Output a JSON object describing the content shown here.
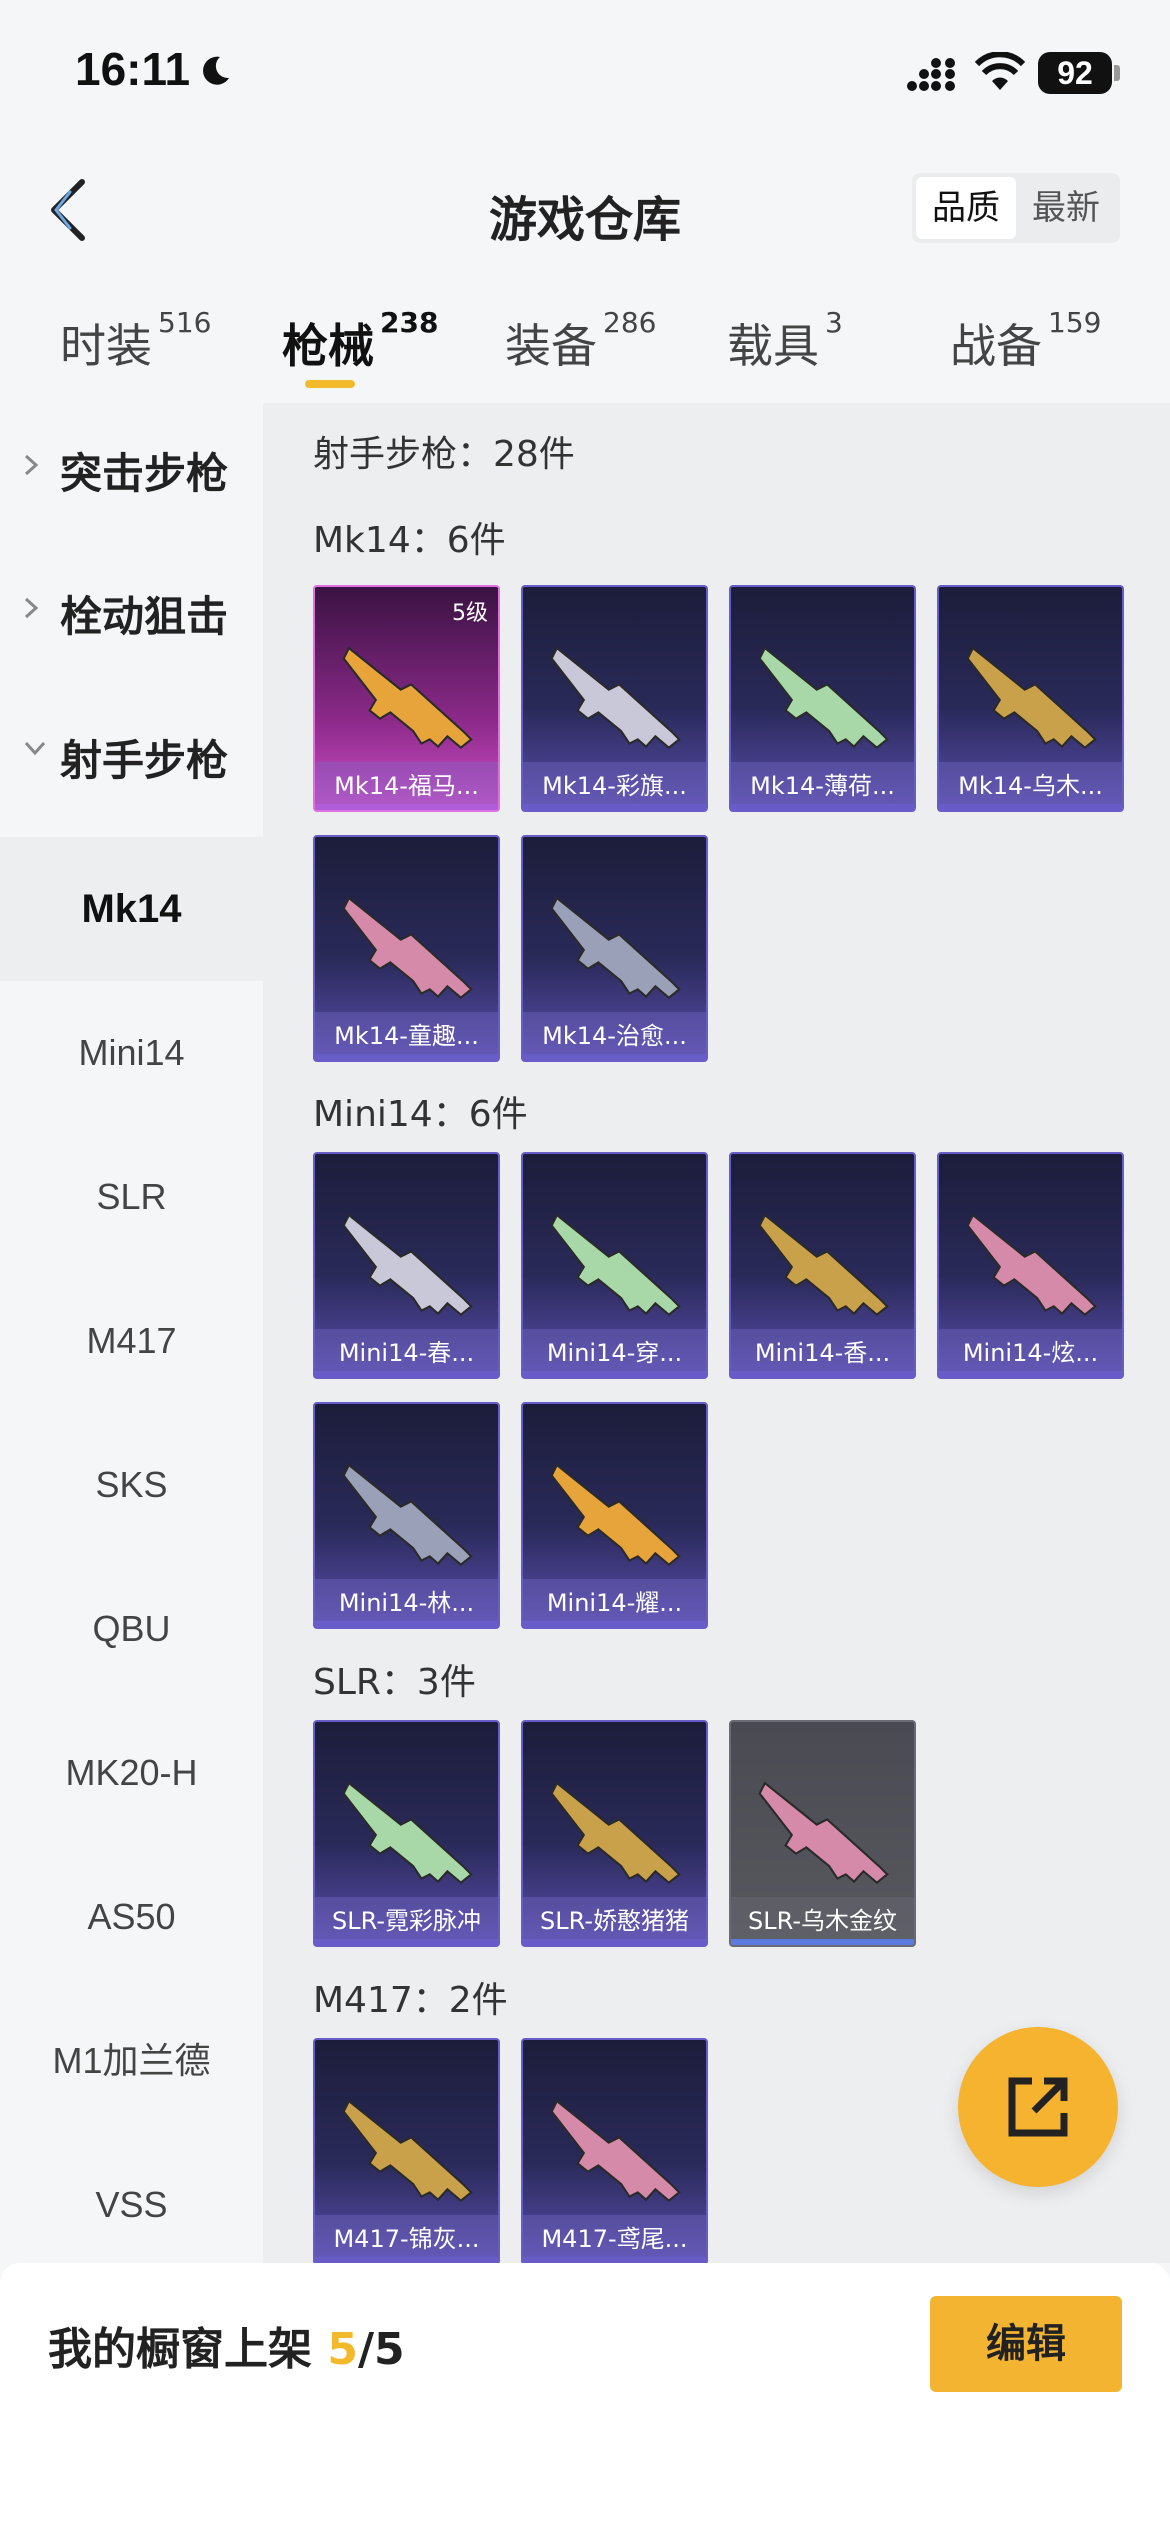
{
  "status": {
    "time": "16:11",
    "battery": "92"
  },
  "header": {
    "title": "游戏仓库",
    "sort": [
      "品质",
      "最新"
    ]
  },
  "tabs": [
    {
      "label": "时装",
      "count": "516"
    },
    {
      "label": "枪械",
      "count": "238"
    },
    {
      "label": "装备",
      "count": "286"
    },
    {
      "label": "载具",
      "count": "3"
    },
    {
      "label": "战备",
      "count": "159"
    }
  ],
  "sidebar": {
    "categories": [
      "突击步枪",
      "栓动狙击",
      "射手步枪"
    ],
    "subitems": [
      "Mk14",
      "Mini14",
      "SLR",
      "M417",
      "SKS",
      "QBU",
      "MK20-H",
      "AS50",
      "M1加兰德",
      "VSS"
    ]
  },
  "content": {
    "section_title": "射手步枪：28件",
    "groups": [
      {
        "title": "Mk14：6件",
        "items": [
          "Mk14-福马...",
          "Mk14-彩旗...",
          "Mk14-薄荷...",
          "Mk14-乌木...",
          "Mk14-童趣...",
          "Mk14-治愈..."
        ],
        "first_level": "5级"
      },
      {
        "title": "Mini14：6件",
        "items": [
          "Mini14-春...",
          "Mini14-穿...",
          "Mini14-香...",
          "Mini14-炫...",
          "Mini14-林...",
          "Mini14-耀..."
        ]
      },
      {
        "title": "SLR：3件",
        "items": [
          "SLR-霓彩脉冲",
          "SLR-娇憨猪猪",
          "SLR-乌木金纹"
        ]
      },
      {
        "title": "M417：2件",
        "items": [
          "M417-锦灰...",
          "M417-鸢尾..."
        ]
      }
    ]
  },
  "bottom": {
    "showcase_label": "我的橱窗上架",
    "showcase_used": "5",
    "showcase_total": "/5",
    "edit_label": "编辑"
  },
  "colors": {
    "accent": "#f2b92a",
    "card_blue": "#5b4fb0",
    "card_pink": "#d050c8"
  }
}
